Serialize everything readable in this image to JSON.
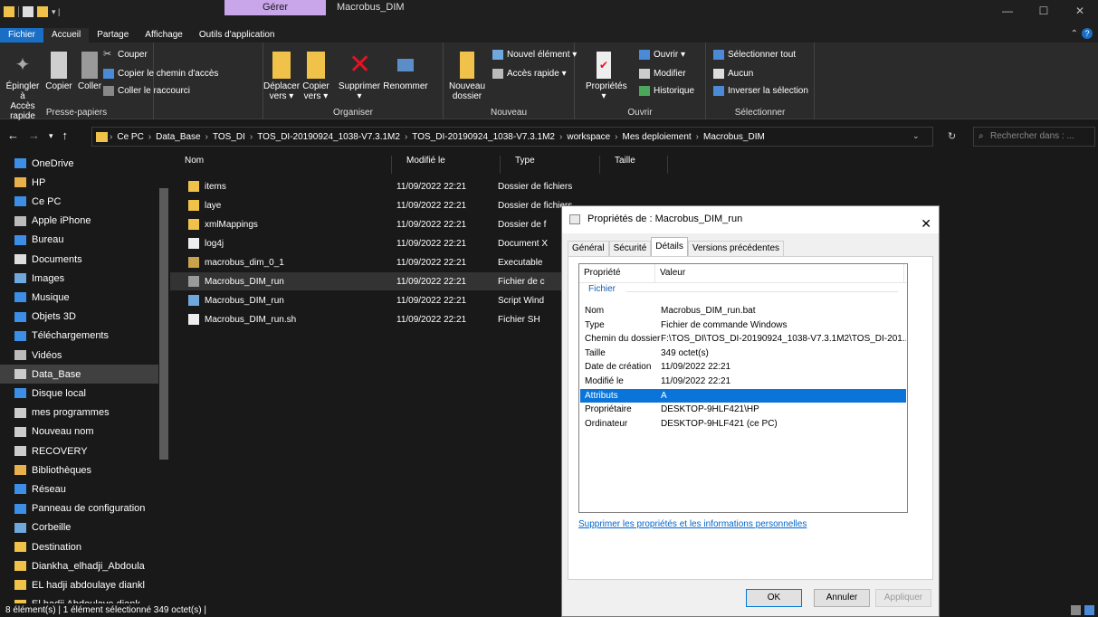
{
  "window": {
    "context_tab": "Gérer",
    "title": "Macrobus_DIM",
    "controls": [
      "—",
      "☐",
      "✕"
    ]
  },
  "ribbon_tabs": [
    "Fichier",
    "Accueil",
    "Partage",
    "Affichage",
    "Outils d'application"
  ],
  "ribbon": {
    "clipboard": {
      "pin": "Épingler à\nAccès rapide",
      "copy": "Copier",
      "paste": "Coller",
      "cut": "Couper",
      "copy_path": "Copier le chemin d'accès",
      "paste_shortcut": "Coller le raccourci",
      "group": "Presse-papiers"
    },
    "organize": {
      "move": "Déplacer\nvers ▾",
      "copy_to": "Copier\nvers ▾",
      "delete": "Supprimer\n▾",
      "rename": "Renommer",
      "group": "Organiser"
    },
    "new": {
      "new_folder": "Nouveau\ndossier",
      "new_item": "Nouvel élément ▾",
      "quick_access": "Accès rapide ▾",
      "group": "Nouveau"
    },
    "open": {
      "properties": "Propriétés\n▾",
      "open": "Ouvrir ▾",
      "edit": "Modifier",
      "history": "Historique",
      "group": "Ouvrir"
    },
    "select": {
      "select_all": "Sélectionner tout",
      "select_none": "Aucun",
      "invert": "Inverser la sélection",
      "group": "Sélectionner"
    }
  },
  "address": {
    "crumbs": [
      "Ce PC",
      "Data_Base",
      "TOS_DI",
      "TOS_DI-20190924_1038-V7.3.1M2",
      "TOS_DI-20190924_1038-V7.3.1M2",
      "workspace",
      "Mes deploiement",
      "Macrobus_DIM"
    ],
    "search_placeholder": "Rechercher dans : ..."
  },
  "sidebar": [
    {
      "label": "OneDrive",
      "icon": "cloud-icon",
      "color": "#3c8ee6"
    },
    {
      "label": "HP",
      "icon": "user-icon",
      "color": "#e8b04a"
    },
    {
      "label": "Ce PC",
      "icon": "computer-icon",
      "color": "#3c8ee6"
    },
    {
      "label": "Apple iPhone",
      "icon": "phone-icon",
      "color": "#bbbbbb"
    },
    {
      "label": "Bureau",
      "icon": "desktop-icon",
      "color": "#3c8ee6"
    },
    {
      "label": "Documents",
      "icon": "document-icon",
      "color": "#dddddd"
    },
    {
      "label": "Images",
      "icon": "image-icon",
      "color": "#6fa8dc"
    },
    {
      "label": "Musique",
      "icon": "music-icon",
      "color": "#3c8ee6"
    },
    {
      "label": "Objets 3D",
      "icon": "cube-icon",
      "color": "#3c8ee6"
    },
    {
      "label": "Téléchargements",
      "icon": "download-icon",
      "color": "#3c8ee6"
    },
    {
      "label": "Vidéos",
      "icon": "video-icon",
      "color": "#bbbbbb"
    },
    {
      "label": "Data_Base",
      "icon": "drive-icon",
      "color": "#cccccc",
      "selected": true
    },
    {
      "label": "Disque local",
      "icon": "drive-icon",
      "color": "#3c8ee6"
    },
    {
      "label": "mes programmes",
      "icon": "drive-icon",
      "color": "#cccccc"
    },
    {
      "label": "Nouveau nom",
      "icon": "drive-icon",
      "color": "#cccccc"
    },
    {
      "label": "RECOVERY",
      "icon": "drive-icon",
      "color": "#cccccc"
    },
    {
      "label": "Bibliothèques",
      "icon": "library-icon",
      "color": "#e8b04a"
    },
    {
      "label": "Réseau",
      "icon": "network-icon",
      "color": "#3c8ee6"
    },
    {
      "label": "Panneau de configuration",
      "icon": "control-panel-icon",
      "color": "#3c8ee6"
    },
    {
      "label": "Corbeille",
      "icon": "recycle-bin-icon",
      "color": "#6fa8dc"
    },
    {
      "label": "Destination",
      "icon": "folder-icon",
      "color": "#f0c24a"
    },
    {
      "label": "Diankha_elhadji_Abdoula",
      "icon": "folder-icon",
      "color": "#f0c24a"
    },
    {
      "label": "EL hadji abdoulaye diankl",
      "icon": "folder-icon",
      "color": "#f0c24a"
    },
    {
      "label": "El hadji Abdoulaye diank",
      "icon": "folder-icon",
      "color": "#f0c24a"
    }
  ],
  "columns": [
    "Nom",
    "Modifié le",
    "Type",
    "Taille"
  ],
  "files": [
    {
      "name": "items",
      "date": "11/09/2022 22:21",
      "type": "Dossier de fichiers",
      "icon": "folder-icon",
      "color": "#f0c24a"
    },
    {
      "name": "laye",
      "date": "11/09/2022 22:21",
      "type": "Dossier de fichiers",
      "icon": "folder-icon",
      "color": "#f0c24a"
    },
    {
      "name": "xmlMappings",
      "date": "11/09/2022 22:21",
      "type": "Dossier de f",
      "icon": "folder-icon",
      "color": "#f0c24a"
    },
    {
      "name": "log4j",
      "date": "11/09/2022 22:21",
      "type": "Document X",
      "icon": "file-icon",
      "color": "#eeeeee"
    },
    {
      "name": "macrobus_dim_0_1",
      "date": "11/09/2022 22:21",
      "type": "Executable",
      "icon": "executable-icon",
      "color": "#c9a34a"
    },
    {
      "name": "Macrobus_DIM_run",
      "date": "11/09/2022 22:21",
      "type": "Fichier de c",
      "icon": "batch-file-icon",
      "color": "#9a9a9a",
      "selected": true
    },
    {
      "name": "Macrobus_DIM_run",
      "date": "11/09/2022 22:21",
      "type": "Script Wind",
      "icon": "script-icon",
      "color": "#6fa8dc"
    },
    {
      "name": "Macrobus_DIM_run.sh",
      "date": "11/09/2022 22:21",
      "type": "Fichier SH",
      "icon": "file-icon",
      "color": "#eeeeee"
    }
  ],
  "status": "8 élément(s)  |  1 élément sélectionné  349 octet(s)  |",
  "dialog": {
    "title": "Propriétés de : Macrobus_DIM_run",
    "tabs": [
      "Général",
      "Sécurité",
      "Détails",
      "Versions précédentes"
    ],
    "active_tab": "Détails",
    "head_property": "Propriété",
    "head_value": "Valeur",
    "section": "Fichier",
    "rows": [
      {
        "k": "Nom",
        "v": "Macrobus_DIM_run.bat"
      },
      {
        "k": "Type",
        "v": "Fichier de commande Windows"
      },
      {
        "k": "Chemin du dossier",
        "v": "F:\\TOS_DI\\TOS_DI-20190924_1038-V7.3.1M2\\TOS_DI-201..."
      },
      {
        "k": "Taille",
        "v": "349 octet(s)"
      },
      {
        "k": "Date de création",
        "v": "11/09/2022 22:21"
      },
      {
        "k": "Modifié le",
        "v": "11/09/2022 22:21"
      },
      {
        "k": "Attributs",
        "v": "A",
        "selected": true
      },
      {
        "k": "Propriétaire",
        "v": "DESKTOP-9HLF421\\HP"
      },
      {
        "k": "Ordinateur",
        "v": "DESKTOP-9HLF421 (ce PC)"
      }
    ],
    "link": "Supprimer les propriétés et les informations personnelles",
    "ok": "OK",
    "cancel": "Annuler",
    "apply": "Appliquer"
  }
}
